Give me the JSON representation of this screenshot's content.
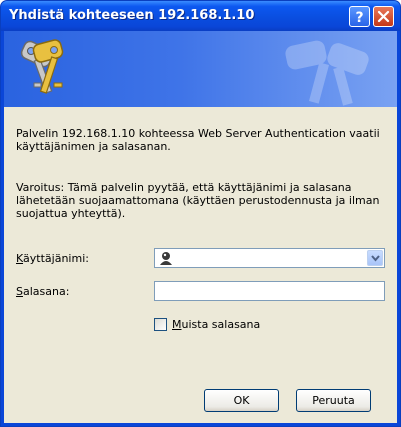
{
  "window": {
    "title": "Yhdistä kohteeseen 192.168.1.10"
  },
  "message": "Palvelin 192.168.1.10 kohteessa Web Server Authentication vaatii käyttäjänimen ja salasanan.",
  "warning": "Varoitus: Tämä palvelin pyytää, että käyttäjänimi ja salasana lähetetään suojaamattomana (käyttäen perustodennusta ja ilman suojattua yhteyttä).",
  "username": {
    "label_mnemonic": "K",
    "label_rest": "äyttäjänimi:",
    "value": ""
  },
  "password": {
    "label_mnemonic": "S",
    "label_rest": "alasana:",
    "value": ""
  },
  "remember": {
    "label_mnemonic": "M",
    "label_rest": "uista salasana",
    "checked": false
  },
  "buttons": {
    "ok": "OK",
    "cancel": "Peruuta"
  }
}
